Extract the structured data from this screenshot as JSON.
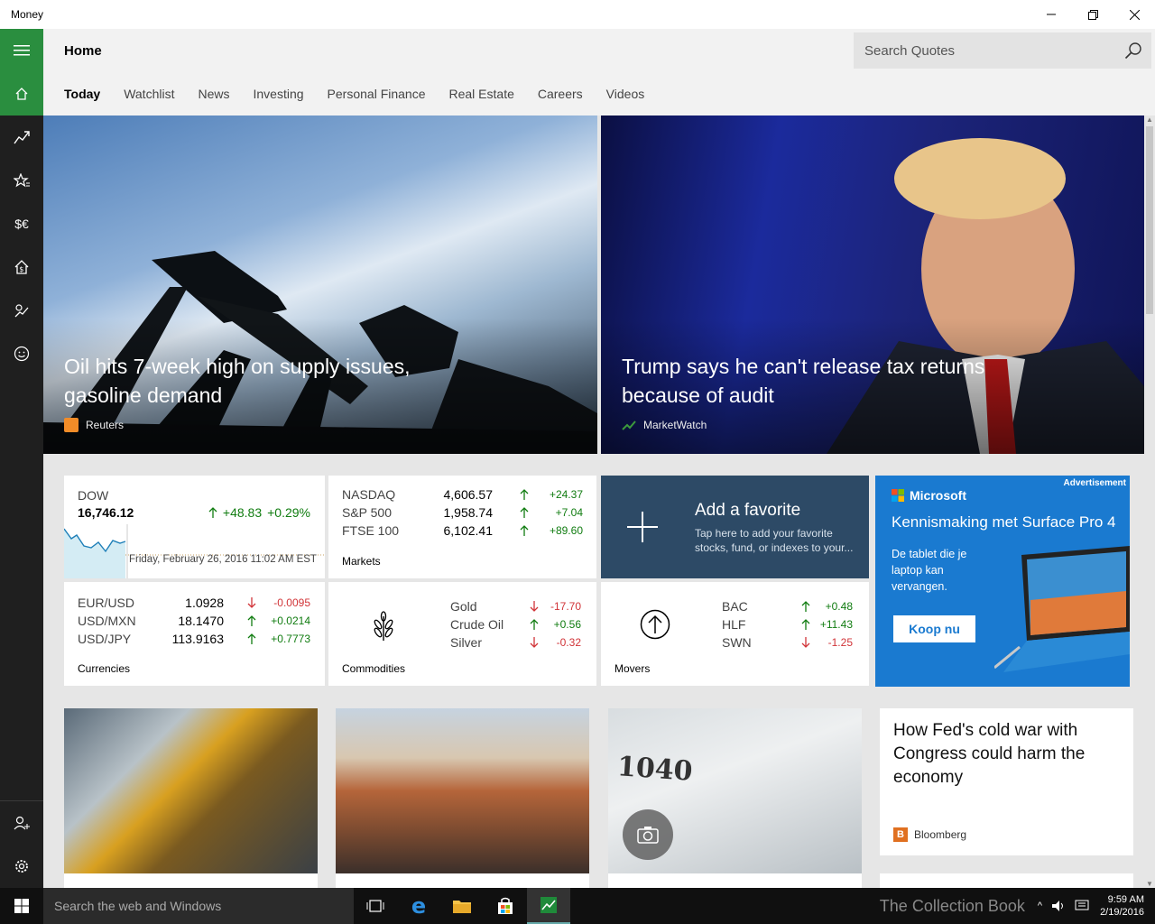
{
  "window": {
    "title": "Money"
  },
  "header": {
    "page_title": "Home",
    "search_placeholder": "Search Quotes"
  },
  "tabs": [
    "Today",
    "Watchlist",
    "News",
    "Investing",
    "Personal Finance",
    "Real Estate",
    "Careers",
    "Videos"
  ],
  "rail_icons": [
    "home-icon",
    "markets-icon",
    "watchlist-icon",
    "currencies-icon",
    "mortgage-icon",
    "retirement-icon",
    "feedback-icon"
  ],
  "heroes": [
    {
      "headline": "Oil hits 7-week high on supply issues, gasoline demand",
      "source": "Reuters"
    },
    {
      "headline": "Trump says he can't release tax returns because of audit",
      "source": "MarketWatch"
    }
  ],
  "dow": {
    "name": "DOW",
    "value": "16,746.12",
    "change": "+48.83",
    "percent": "+0.29%",
    "timestamp": "Friday, February 26, 2016 11:02 AM EST"
  },
  "markets": {
    "caption": "Markets",
    "rows": [
      {
        "name": "NASDAQ",
        "value": "4,606.57",
        "change": "+24.37",
        "dir": "up"
      },
      {
        "name": "S&P 500",
        "value": "1,958.74",
        "change": "+7.04",
        "dir": "up"
      },
      {
        "name": "FTSE 100",
        "value": "6,102.41",
        "change": "+89.60",
        "dir": "up"
      }
    ]
  },
  "add_favorite": {
    "title": "Add a favorite",
    "description": "Tap here to add your favorite stocks, fund, or indexes to your..."
  },
  "currencies": {
    "caption": "Currencies",
    "rows": [
      {
        "name": "EUR/USD",
        "value": "1.0928",
        "change": "-0.0095",
        "dir": "down"
      },
      {
        "name": "USD/MXN",
        "value": "18.1470",
        "change": "+0.0214",
        "dir": "up"
      },
      {
        "name": "USD/JPY",
        "value": "113.9163",
        "change": "+0.7773",
        "dir": "up"
      }
    ]
  },
  "commodities": {
    "caption": "Commodities",
    "rows": [
      {
        "name": "Gold",
        "change": "-17.70",
        "dir": "down"
      },
      {
        "name": "Crude Oil",
        "change": "+0.56",
        "dir": "up"
      },
      {
        "name": "Silver",
        "change": "-0.32",
        "dir": "down"
      }
    ]
  },
  "movers": {
    "caption": "Movers",
    "rows": [
      {
        "name": "BAC",
        "change": "+0.48",
        "dir": "up"
      },
      {
        "name": "HLF",
        "change": "+11.43",
        "dir": "up"
      },
      {
        "name": "SWN",
        "change": "-1.25",
        "dir": "down"
      }
    ]
  },
  "ad": {
    "label": "Advertisement",
    "brand": "Microsoft",
    "headline": "Kennismaking met Surface Pro 4",
    "body": "De tablet die je laptop kan vervangen.",
    "button": "Koop nu"
  },
  "story": {
    "headline": "How Fed's cold war with Congress could harm the economy",
    "source": "Bloomberg"
  },
  "taskbar": {
    "search_placeholder": "Search the web and Windows",
    "time": "9:59 AM",
    "date": "2/19/2016",
    "watermark": "The Collection Book"
  },
  "colors": {
    "accent": "#2a8e3f",
    "up": "#107c10",
    "down": "#d13438",
    "favorite_tile": "#2d4a66",
    "ad_blue": "#1a7ad0"
  }
}
